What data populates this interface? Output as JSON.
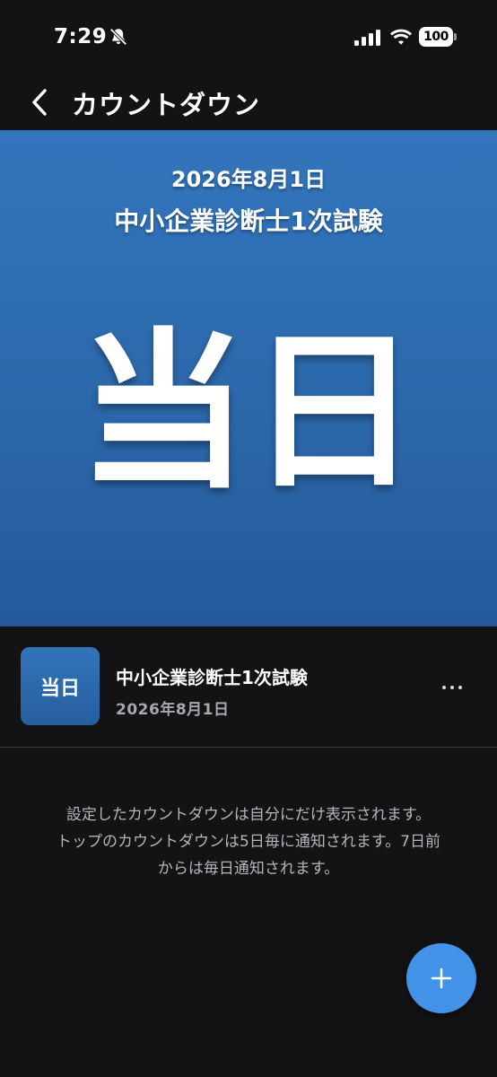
{
  "status_bar": {
    "time": "7:29",
    "battery": "100",
    "icons": [
      "bell-slash-icon",
      "signal-icon",
      "wifi-icon",
      "battery-icon"
    ]
  },
  "nav": {
    "title": "カウントダウン",
    "back_icon": "chevron-left-icon"
  },
  "hero": {
    "date": "2026年8月1日",
    "title": "中小企業診断士1次試験",
    "countdown": "当日"
  },
  "countdown_list": [
    {
      "thumb_label": "当日",
      "title": "中小企業診断士1次試験",
      "date": "2026年8月1日",
      "more_icon": "ellipsis-icon"
    }
  ],
  "info": {
    "line1": "設定したカウントダウンは自分にだけ表示されます。",
    "line2": "トップのカウントダウンは5日毎に通知されます。7日前",
    "line3": "からは毎日通知されます。"
  },
  "fab": {
    "icon": "plus-icon"
  },
  "colors": {
    "background": "#131315",
    "hero": "#2c68aa",
    "accent": "#4292e8",
    "secondary_text": "#a8a8ad"
  }
}
